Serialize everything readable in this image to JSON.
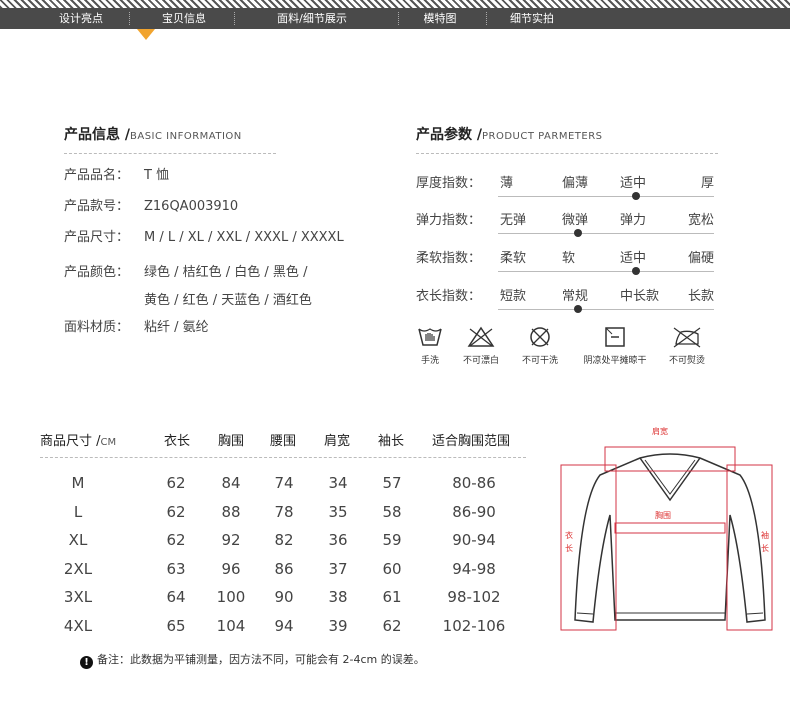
{
  "nav": {
    "items": [
      "设计亮点",
      "宝贝信息",
      "面料/细节展示",
      "模特图",
      "细节实拍"
    ],
    "active_index": 1,
    "accent_color": "#f1a42f"
  },
  "product_info": {
    "title": "产品信息 /",
    "subtitle": "BASIC INFORMATION",
    "rows": [
      {
        "label": "产品品名：",
        "value": "T 恤"
      },
      {
        "label": "产品款号：",
        "value": "Z16QA003910"
      },
      {
        "label": "产品尺寸：",
        "value": "M / L / XL / XXL / XXXL / XXXXL"
      },
      {
        "label": "产品颜色：",
        "value": "绿色 / 桔红色 / 白色 / 黑色 /",
        "value2": "黄色 / 红色 / 天蓝色 / 酒红色"
      },
      {
        "label": "面料材质：",
        "value": "粘纤 / 氨纶"
      }
    ]
  },
  "product_params": {
    "title": "产品参数 /",
    "subtitle": "PRODUCT PARMETERS",
    "rows": [
      {
        "label": "厚度指数：",
        "options": [
          "薄",
          "偏薄",
          "适中",
          "厚"
        ],
        "selected": 2
      },
      {
        "label": "弹力指数：",
        "options": [
          "无弹",
          "微弹",
          "弹力",
          "宽松"
        ],
        "selected": 1
      },
      {
        "label": "柔软指数：",
        "options": [
          "柔软",
          "软",
          "适中",
          "偏硬"
        ],
        "selected": 2
      },
      {
        "label": "衣长指数：",
        "options": [
          "短款",
          "常规",
          "中长款",
          "长款"
        ],
        "selected": 1
      }
    ],
    "care": [
      {
        "icon": "hand-wash-icon",
        "label": "手洗"
      },
      {
        "icon": "no-bleach-icon",
        "label": "不可漂白"
      },
      {
        "icon": "no-tumble-dry-icon",
        "label": "不可干洗"
      },
      {
        "icon": "shade-dry-icon",
        "label": "阴凉处平摊晾干"
      },
      {
        "icon": "no-iron-icon",
        "label": "不可熨烫"
      }
    ]
  },
  "size_table": {
    "title": "商品尺寸 /",
    "unit": "CM",
    "headers": [
      "衣长",
      "胸围",
      "腰围",
      "肩宽",
      "袖长",
      "适合胸围范围"
    ],
    "rows": [
      [
        "M",
        "62",
        "84",
        "74",
        "34",
        "57",
        "80-86"
      ],
      [
        "L",
        "62",
        "88",
        "78",
        "35",
        "58",
        "86-90"
      ],
      [
        "XL",
        "62",
        "92",
        "82",
        "36",
        "59",
        "90-94"
      ],
      [
        "2XL",
        "63",
        "96",
        "86",
        "37",
        "60",
        "94-98"
      ],
      [
        "3XL",
        "64",
        "100",
        "90",
        "38",
        "61",
        "98-102"
      ],
      [
        "4XL",
        "65",
        "104",
        "94",
        "39",
        "62",
        "102-106"
      ]
    ],
    "note_mark": "!",
    "note": "备注：此数据为平铺测量，因方法不同，可能会有 2-4cm 的误差。"
  },
  "diagram": {
    "shoulder": "肩宽",
    "chest": "胸围",
    "length_chars": [
      "衣",
      "长"
    ],
    "sleeve_chars": [
      "袖",
      "长"
    ],
    "measure_color": "#d33344"
  }
}
